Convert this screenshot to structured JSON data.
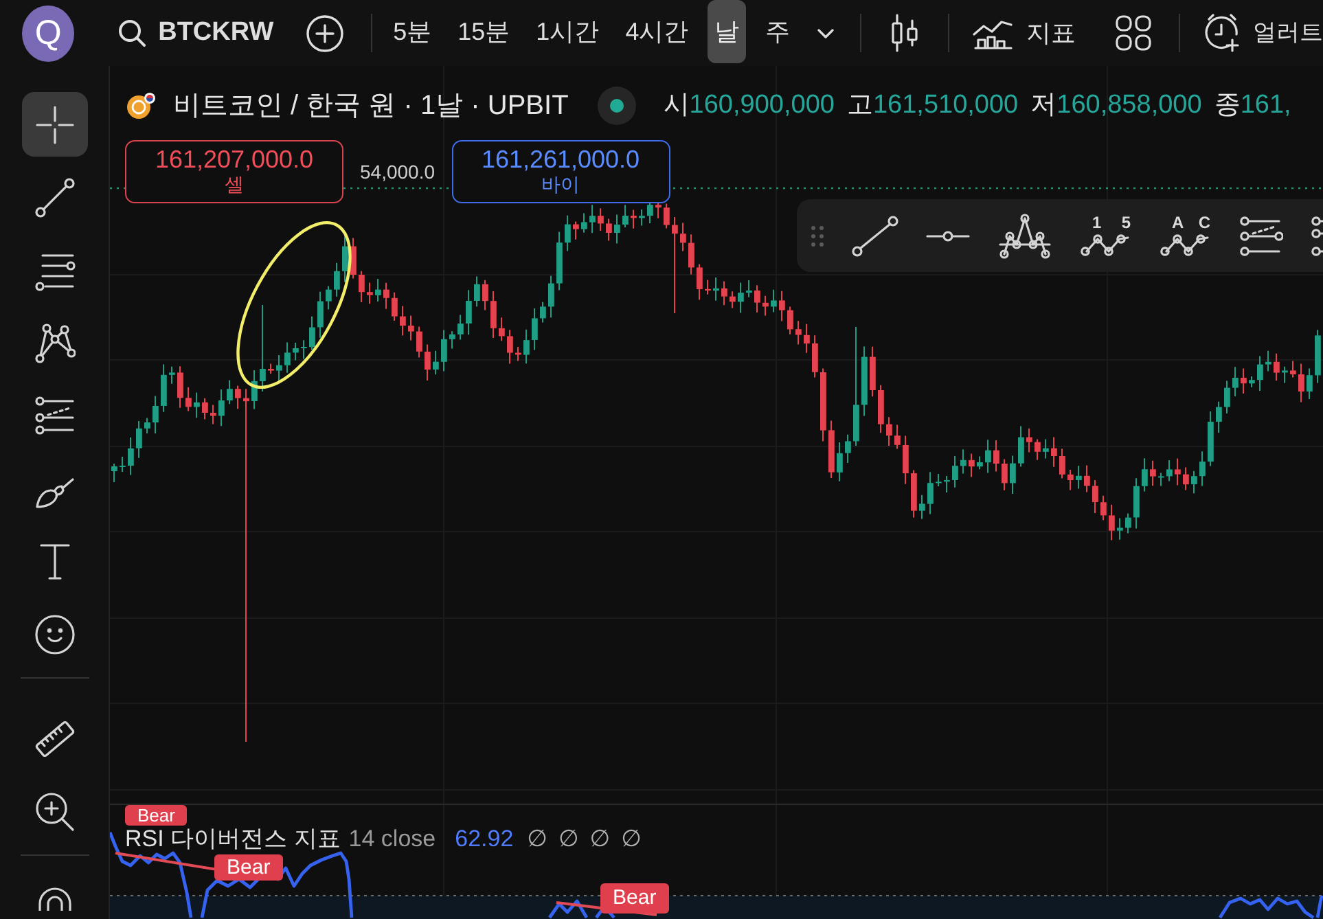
{
  "top_bar": {
    "avatar": "Q",
    "symbol": "BTCKRW",
    "timeframes": [
      {
        "label": "5분",
        "selected": false
      },
      {
        "label": "15분",
        "selected": false
      },
      {
        "label": "1시간",
        "selected": false
      },
      {
        "label": "4시간",
        "selected": false
      },
      {
        "label": "날",
        "selected": true
      },
      {
        "label": "주",
        "selected": false
      }
    ],
    "indicators": "지표",
    "alerts": "얼러트"
  },
  "left_toolbar": {
    "groups": [
      {
        "tools": [
          {
            "kind": "crosshair",
            "selected": true
          },
          {
            "kind": "trend-line",
            "selected": false
          },
          {
            "kind": "parallel-lines",
            "selected": false
          },
          {
            "kind": "pattern",
            "selected": false
          },
          {
            "kind": "fib",
            "selected": false
          },
          {
            "kind": "brush",
            "selected": false
          },
          {
            "kind": "text",
            "selected": false
          },
          {
            "kind": "emoji",
            "selected": false
          }
        ]
      },
      {
        "tools": [
          {
            "kind": "ruler",
            "selected": false
          },
          {
            "kind": "zoom-in",
            "selected": false
          }
        ]
      },
      {
        "tools": [
          {
            "kind": "magnet",
            "selected": false
          }
        ]
      }
    ]
  },
  "chart": {
    "title": "비트코인 / 한국 원 · 1날 · UPBIT",
    "ohlc": [
      {
        "label": "시",
        "value": "160,900,000"
      },
      {
        "label": "고",
        "value": "161,510,000"
      },
      {
        "label": "저",
        "value": "160,858,000"
      },
      {
        "label": "종",
        "value": "161,"
      }
    ],
    "sell": {
      "price": "161,207,000.0",
      "label": "셀"
    },
    "spread": "54,000.0",
    "buy": {
      "price": "161,261,000.0",
      "label": "바이"
    }
  },
  "drawing_toolbar": {
    "tools": [
      {
        "kind": "trend-line"
      },
      {
        "kind": "horizontal-ray"
      },
      {
        "kind": "head-shoulders"
      },
      {
        "kind": "wave",
        "marks": [
          "1",
          "5"
        ]
      },
      {
        "kind": "wave",
        "marks": [
          "A",
          "C"
        ]
      },
      {
        "kind": "fib-channel"
      },
      {
        "kind": "fib-channel-cut"
      }
    ]
  },
  "indicator_pane": {
    "name": "RSI 다이버전스 지표",
    "params": "14 close",
    "value": "62.92",
    "flags": [
      "∅",
      "∅",
      "∅",
      "∅"
    ],
    "signals": [
      {
        "label": "Bear"
      },
      {
        "label": "Bear"
      },
      {
        "label": "Bear"
      }
    ]
  }
}
